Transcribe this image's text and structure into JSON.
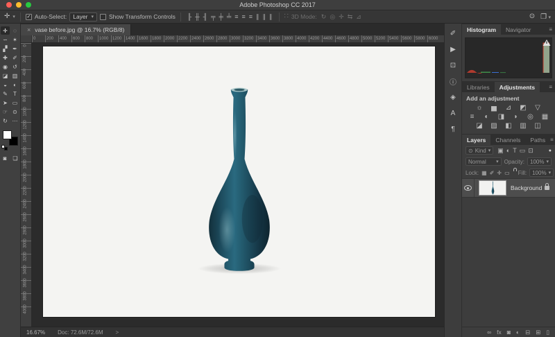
{
  "titlebar": {
    "title": "Adobe Photoshop CC 2017"
  },
  "ui": {
    "caret": "▾",
    "menu": "≡",
    "search": "⊙",
    "workspace": "❐",
    "check": "✓",
    "dots": "∷"
  },
  "options": {
    "tool_glyph": "✛",
    "auto_select_label": "Auto-Select:",
    "auto_select_value": "Layer",
    "auto_select_checked": true,
    "show_transform_label": "Show Transform Controls",
    "show_transform_checked": false,
    "align_icons": [
      {
        "name": "align-left-edges-button",
        "glyph": "╟"
      },
      {
        "name": "align-horizontal-centers-button",
        "glyph": "╫"
      },
      {
        "name": "align-right-edges-button",
        "glyph": "╢"
      },
      {
        "name": "align-top-edges-button",
        "glyph": "╤"
      },
      {
        "name": "align-vertical-centers-button",
        "glyph": "╪"
      },
      {
        "name": "align-bottom-edges-button",
        "glyph": "╧"
      },
      {
        "name": "distribute-top-edges-button",
        "glyph": "≡"
      },
      {
        "name": "distribute-vertical-centers-button",
        "glyph": "≡"
      },
      {
        "name": "distribute-bottom-edges-button",
        "glyph": "≡"
      },
      {
        "name": "distribute-left-edges-button",
        "glyph": "∥"
      },
      {
        "name": "distribute-horizontal-centers-button",
        "glyph": "∥"
      },
      {
        "name": "distribute-right-edges-button",
        "glyph": "∥"
      }
    ],
    "mode3d_label": "3D Mode:",
    "mode3d_icons": [
      {
        "name": "3d-rotate-icon",
        "glyph": "↻"
      },
      {
        "name": "3d-roll-icon",
        "glyph": "◎"
      },
      {
        "name": "3d-drag-icon",
        "glyph": "✛"
      },
      {
        "name": "3d-slide-icon",
        "glyph": "⇆"
      },
      {
        "name": "3d-scale-icon",
        "glyph": "⊿"
      }
    ]
  },
  "document_tab": {
    "close": "×",
    "title": "vase before.jpg @ 16.7% (RGB/8)"
  },
  "rulers": {
    "horizontal": [
      "0",
      "200",
      "400",
      "600",
      "800",
      "1000",
      "1200",
      "1400",
      "1600",
      "1800",
      "2000",
      "2200",
      "2400",
      "2600",
      "2800",
      "3000",
      "3200",
      "3400",
      "3600",
      "3800",
      "4000",
      "4200",
      "4400",
      "4600",
      "4800",
      "5000",
      "5200",
      "5400",
      "5600",
      "5800",
      "6000"
    ],
    "vertical": [
      "0",
      "200",
      "400",
      "600",
      "800",
      "1000",
      "1200",
      "1400",
      "1600",
      "1800",
      "2000",
      "2200",
      "2400",
      "2600",
      "2800",
      "3000",
      "3200",
      "3400",
      "3600",
      "3800",
      "4000"
    ]
  },
  "toolbar": {
    "tools": [
      {
        "name": "move-tool",
        "glyph": "✛",
        "cls": "sel"
      },
      {
        "name": "marquee-tool",
        "glyph": "◌"
      },
      {
        "name": "lasso-tool",
        "glyph": "∽"
      },
      {
        "name": "quick-selection-tool",
        "glyph": "✶"
      },
      {
        "name": "crop-tool",
        "glyph": "▞"
      },
      {
        "name": "eyedropper-tool",
        "glyph": "✒"
      },
      {
        "name": "spot-healing-brush-tool",
        "glyph": "✚"
      },
      {
        "name": "brush-tool",
        "glyph": "✐"
      },
      {
        "name": "clone-stamp-tool",
        "glyph": "◉"
      },
      {
        "name": "history-brush-tool",
        "glyph": "↺"
      },
      {
        "name": "eraser-tool",
        "glyph": "◪"
      },
      {
        "name": "gradient-tool",
        "glyph": "▥"
      },
      {
        "name": "blur-tool",
        "glyph": "◒"
      },
      {
        "name": "dodge-tool",
        "glyph": "◐"
      },
      {
        "name": "pen-tool",
        "glyph": "✎"
      },
      {
        "name": "type-tool",
        "glyph": "T"
      },
      {
        "name": "path-selection-tool",
        "glyph": "➤"
      },
      {
        "name": "rectangle-tool",
        "glyph": "▭"
      },
      {
        "name": "hand-tool",
        "glyph": "☞"
      },
      {
        "name": "zoom-tool",
        "glyph": "⊙"
      },
      {
        "name": "rotate-view-tool",
        "glyph": "↻"
      },
      {
        "name": "edit-toolbar-button",
        "glyph": "⋯"
      }
    ],
    "bottom": [
      {
        "name": "quick-mask-button",
        "glyph": "◙"
      },
      {
        "name": "screen-mode-button",
        "glyph": "❏"
      }
    ]
  },
  "statusbar": {
    "zoom": "16.67%",
    "doc": "Doc: 72.6M/72.6M",
    "chevron": ">"
  },
  "dock": [
    {
      "name": "brush-settings-panel-icon",
      "glyph": "✐"
    },
    {
      "name": "actions-panel-icon",
      "glyph": "▶"
    },
    {
      "name": "clone-source-panel-icon",
      "glyph": "⊡"
    },
    {
      "name": "info-panel-icon",
      "glyph": "ⓘ"
    },
    {
      "name": "tool-presets-panel-icon",
      "glyph": "◈"
    },
    {
      "name": "character-panel-icon",
      "glyph": "A"
    },
    {
      "name": "paragraph-panel-icon",
      "glyph": "¶"
    }
  ],
  "histogram_panel": {
    "tabs": [
      {
        "name": "tab-histogram",
        "label": "Histogram",
        "cls": "active"
      },
      {
        "name": "tab-navigator",
        "label": "Navigator"
      }
    ]
  },
  "adjustments_panel": {
    "tabs": [
      {
        "name": "tab-libraries",
        "label": "Libraries"
      },
      {
        "name": "tab-adjustments",
        "label": "Adjustments",
        "cls": "active"
      }
    ],
    "heading": "Add an adjustment",
    "rows": {
      "row1": [
        {
          "name": "brightness-contrast-adjustment-icon",
          "glyph": "☼"
        },
        {
          "name": "levels-adjustment-icon",
          "glyph": "▅"
        },
        {
          "name": "curves-adjustment-icon",
          "glyph": "⊿"
        },
        {
          "name": "exposure-adjustment-icon",
          "glyph": "◩"
        },
        {
          "name": "vibrance-adjustment-icon",
          "glyph": "▽"
        }
      ],
      "row2": [
        {
          "name": "hue-saturation-adjustment-icon",
          "glyph": "≡"
        },
        {
          "name": "color-balance-adjustment-icon",
          "glyph": "◐"
        },
        {
          "name": "black-white-adjustment-icon",
          "glyph": "◨"
        },
        {
          "name": "photo-filter-adjustment-icon",
          "glyph": "◗"
        },
        {
          "name": "channel-mixer-adjustment-icon",
          "glyph": "◎"
        },
        {
          "name": "color-lookup-adjustment-icon",
          "glyph": "▦"
        }
      ],
      "row3": [
        {
          "name": "invert-adjustment-icon",
          "glyph": "◪"
        },
        {
          "name": "posterize-adjustment-icon",
          "glyph": "▨"
        },
        {
          "name": "threshold-adjustment-icon",
          "glyph": "◧"
        },
        {
          "name": "gradient-map-adjustment-icon",
          "glyph": "▥"
        },
        {
          "name": "selective-color-adjustment-icon",
          "glyph": "◫"
        }
      ]
    }
  },
  "layers_panel": {
    "tabs": [
      {
        "name": "tab-layers",
        "label": "Layers",
        "cls": "active"
      },
      {
        "name": "tab-channels",
        "label": "Channels"
      },
      {
        "name": "tab-paths",
        "label": "Paths"
      }
    ],
    "filter_label": "Kind",
    "filter_icons": [
      {
        "name": "filter-pixel-layers-icon",
        "glyph": "▣"
      },
      {
        "name": "filter-adjustment-layers-icon",
        "glyph": "◐"
      },
      {
        "name": "filter-type-layers-icon",
        "glyph": "T"
      },
      {
        "name": "filter-shape-layers-icon",
        "glyph": "▭"
      },
      {
        "name": "filter-smart-objects-icon",
        "glyph": "⊡"
      }
    ],
    "blend_mode": "Normal",
    "opacity_label": "Opacity:",
    "opacity_value": "100%",
    "lock_label": "Lock:",
    "lock_icons": [
      {
        "name": "lock-transparency-icon",
        "glyph": "▦"
      },
      {
        "name": "lock-paint-icon",
        "glyph": "✐"
      },
      {
        "name": "lock-position-icon",
        "glyph": "✛"
      },
      {
        "name": "lock-artboard-icon",
        "glyph": "▭"
      }
    ],
    "fill_label": "Fill:",
    "fill_value": "100%",
    "layer_name": "Background",
    "footer_icons": [
      {
        "name": "link-layers-icon",
        "glyph": "∞"
      },
      {
        "name": "layer-style-icon",
        "glyph": "fx",
        "cls": "rm"
      },
      {
        "name": "add-layer-mask-icon",
        "glyph": "◙",
        "cls": "rm"
      },
      {
        "name": "new-adjustment-layer-icon",
        "glyph": "◐",
        "cls": "rm"
      },
      {
        "name": "new-group-icon",
        "glyph": "⊟",
        "cls": "rm"
      },
      {
        "name": "new-layer-icon",
        "glyph": "⊞",
        "cls": "rm"
      },
      {
        "name": "delete-layer-icon",
        "glyph": "▯",
        "cls": "rm"
      }
    ]
  },
  "colors": {
    "chrome": "#3a3a3a",
    "canvas_surround": "#2b2b2b",
    "photo_bg": "#f4f4f2",
    "vase_teal": "#1f5064",
    "histogram_fill": "#93a38b",
    "traffic_red": "#ff5f57",
    "traffic_yellow": "#febc2e",
    "traffic_green": "#28c840"
  }
}
